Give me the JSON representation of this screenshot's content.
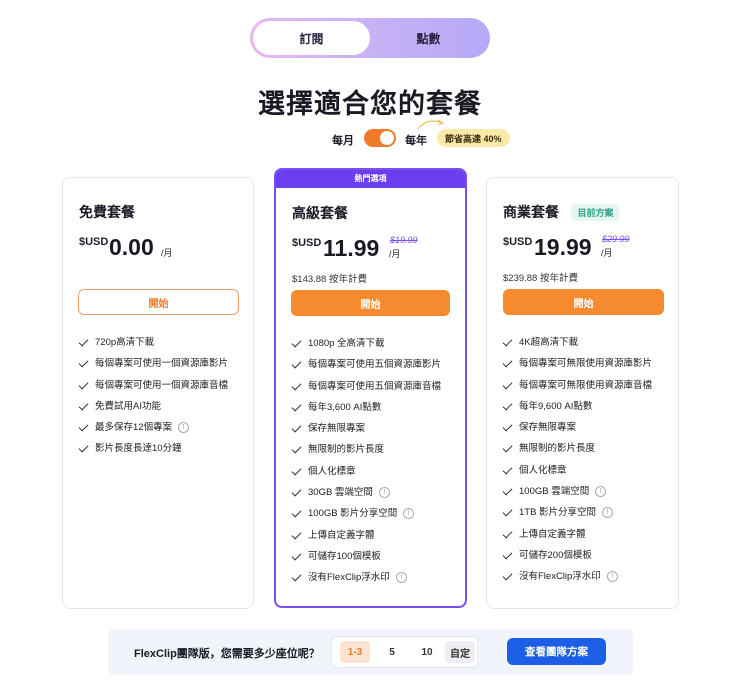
{
  "segment": {
    "subscription": "訂閱",
    "credits": "點數"
  },
  "page_title": "選擇適合您的套餐",
  "billing": {
    "monthly": "每月",
    "yearly": "每年",
    "save_badge": "節省高達 40%"
  },
  "plans": {
    "free": {
      "name": "免費套餐",
      "currency": "$USD",
      "price": "0.00",
      "per": "/月",
      "button": "開始",
      "features": [
        "720p高清下載",
        "每個專案可使用一個資源庫影片",
        "每個專案可使用一個資源庫音檔",
        "免費試用AI功能",
        "最多保存12個專案",
        "影片長度長達10分鐘"
      ]
    },
    "pro": {
      "popular": "熱門選項",
      "name": "高級套餐",
      "currency": "$USD",
      "price": "11.99",
      "per": "/月",
      "old_price": "$19.99",
      "annual": "$143.88 按年計費",
      "button": "開始",
      "features": [
        "1080p 全高清下載",
        "每個專案可使用五個資源庫影片",
        "每個專案可使用五個資源庫音檔",
        "每年3,600 AI點數",
        "保存無限專案",
        "無限制的影片長度",
        "個人化標章",
        "30GB 雲端空間",
        "100GB 影片分享空間",
        "上傳自定義字體",
        "可儲存100個模板",
        "沒有FlexClip浮水印"
      ]
    },
    "biz": {
      "name": "商業套餐",
      "current": "目前方案",
      "currency": "$USD",
      "price": "19.99",
      "per": "/月",
      "old_price": "$29.99",
      "annual": "$239.88 按年計費",
      "button": "開始",
      "features": [
        "4K超高清下載",
        "每個專案可無限使用資源庫影片",
        "每個專案可無限使用資源庫音檔",
        "每年9,600 AI點數",
        "保存無限專案",
        "無限制的影片長度",
        "個人化標章",
        "100GB 雲端空間",
        "1TB 影片分享空間",
        "上傳自定義字體",
        "可儲存200個模板",
        "沒有FlexClip浮水印"
      ]
    }
  },
  "team": {
    "question": "FlexClip團隊版，您需要多少座位呢？",
    "seats": [
      "1-3",
      "5",
      "10",
      "自定"
    ],
    "button": "查看團隊方案"
  },
  "colors": {
    "accent_orange": "#f58a2e",
    "accent_purple": "#6b3ef0",
    "team_blue": "#1c5fe6"
  }
}
